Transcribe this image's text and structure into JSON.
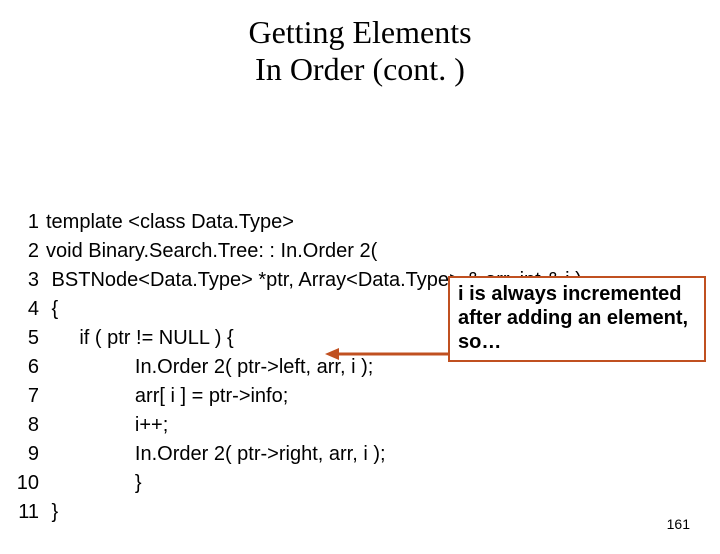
{
  "title_line1": "Getting Elements",
  "title_line2": "In Order (cont. )",
  "code": [
    {
      "n": "1",
      "t": "template <class Data.Type>"
    },
    {
      "n": "2",
      "t": "void Binary.Search.Tree: : In.Order 2("
    },
    {
      "n": "3",
      "t": " BSTNode<Data.Type> *ptr, Array<Data.Type> & arr, int & i )"
    },
    {
      "n": "4",
      "t": " {"
    },
    {
      "n": "5",
      "t": "      if ( ptr != NULL ) {"
    },
    {
      "n": "6",
      "t": "                In.Order 2( ptr->left, arr, i );"
    },
    {
      "n": "7",
      "t": "                arr[ i ] = ptr->info;"
    },
    {
      "n": "8",
      "t": "                i++;"
    },
    {
      "n": "9",
      "t": "                In.Order 2( ptr->right, arr, i );"
    },
    {
      "n": "10",
      "t": "                }"
    },
    {
      "n": "11",
      "t": " }"
    }
  ],
  "callout": "i is always incremented after adding an element, so…",
  "page_number": "161"
}
